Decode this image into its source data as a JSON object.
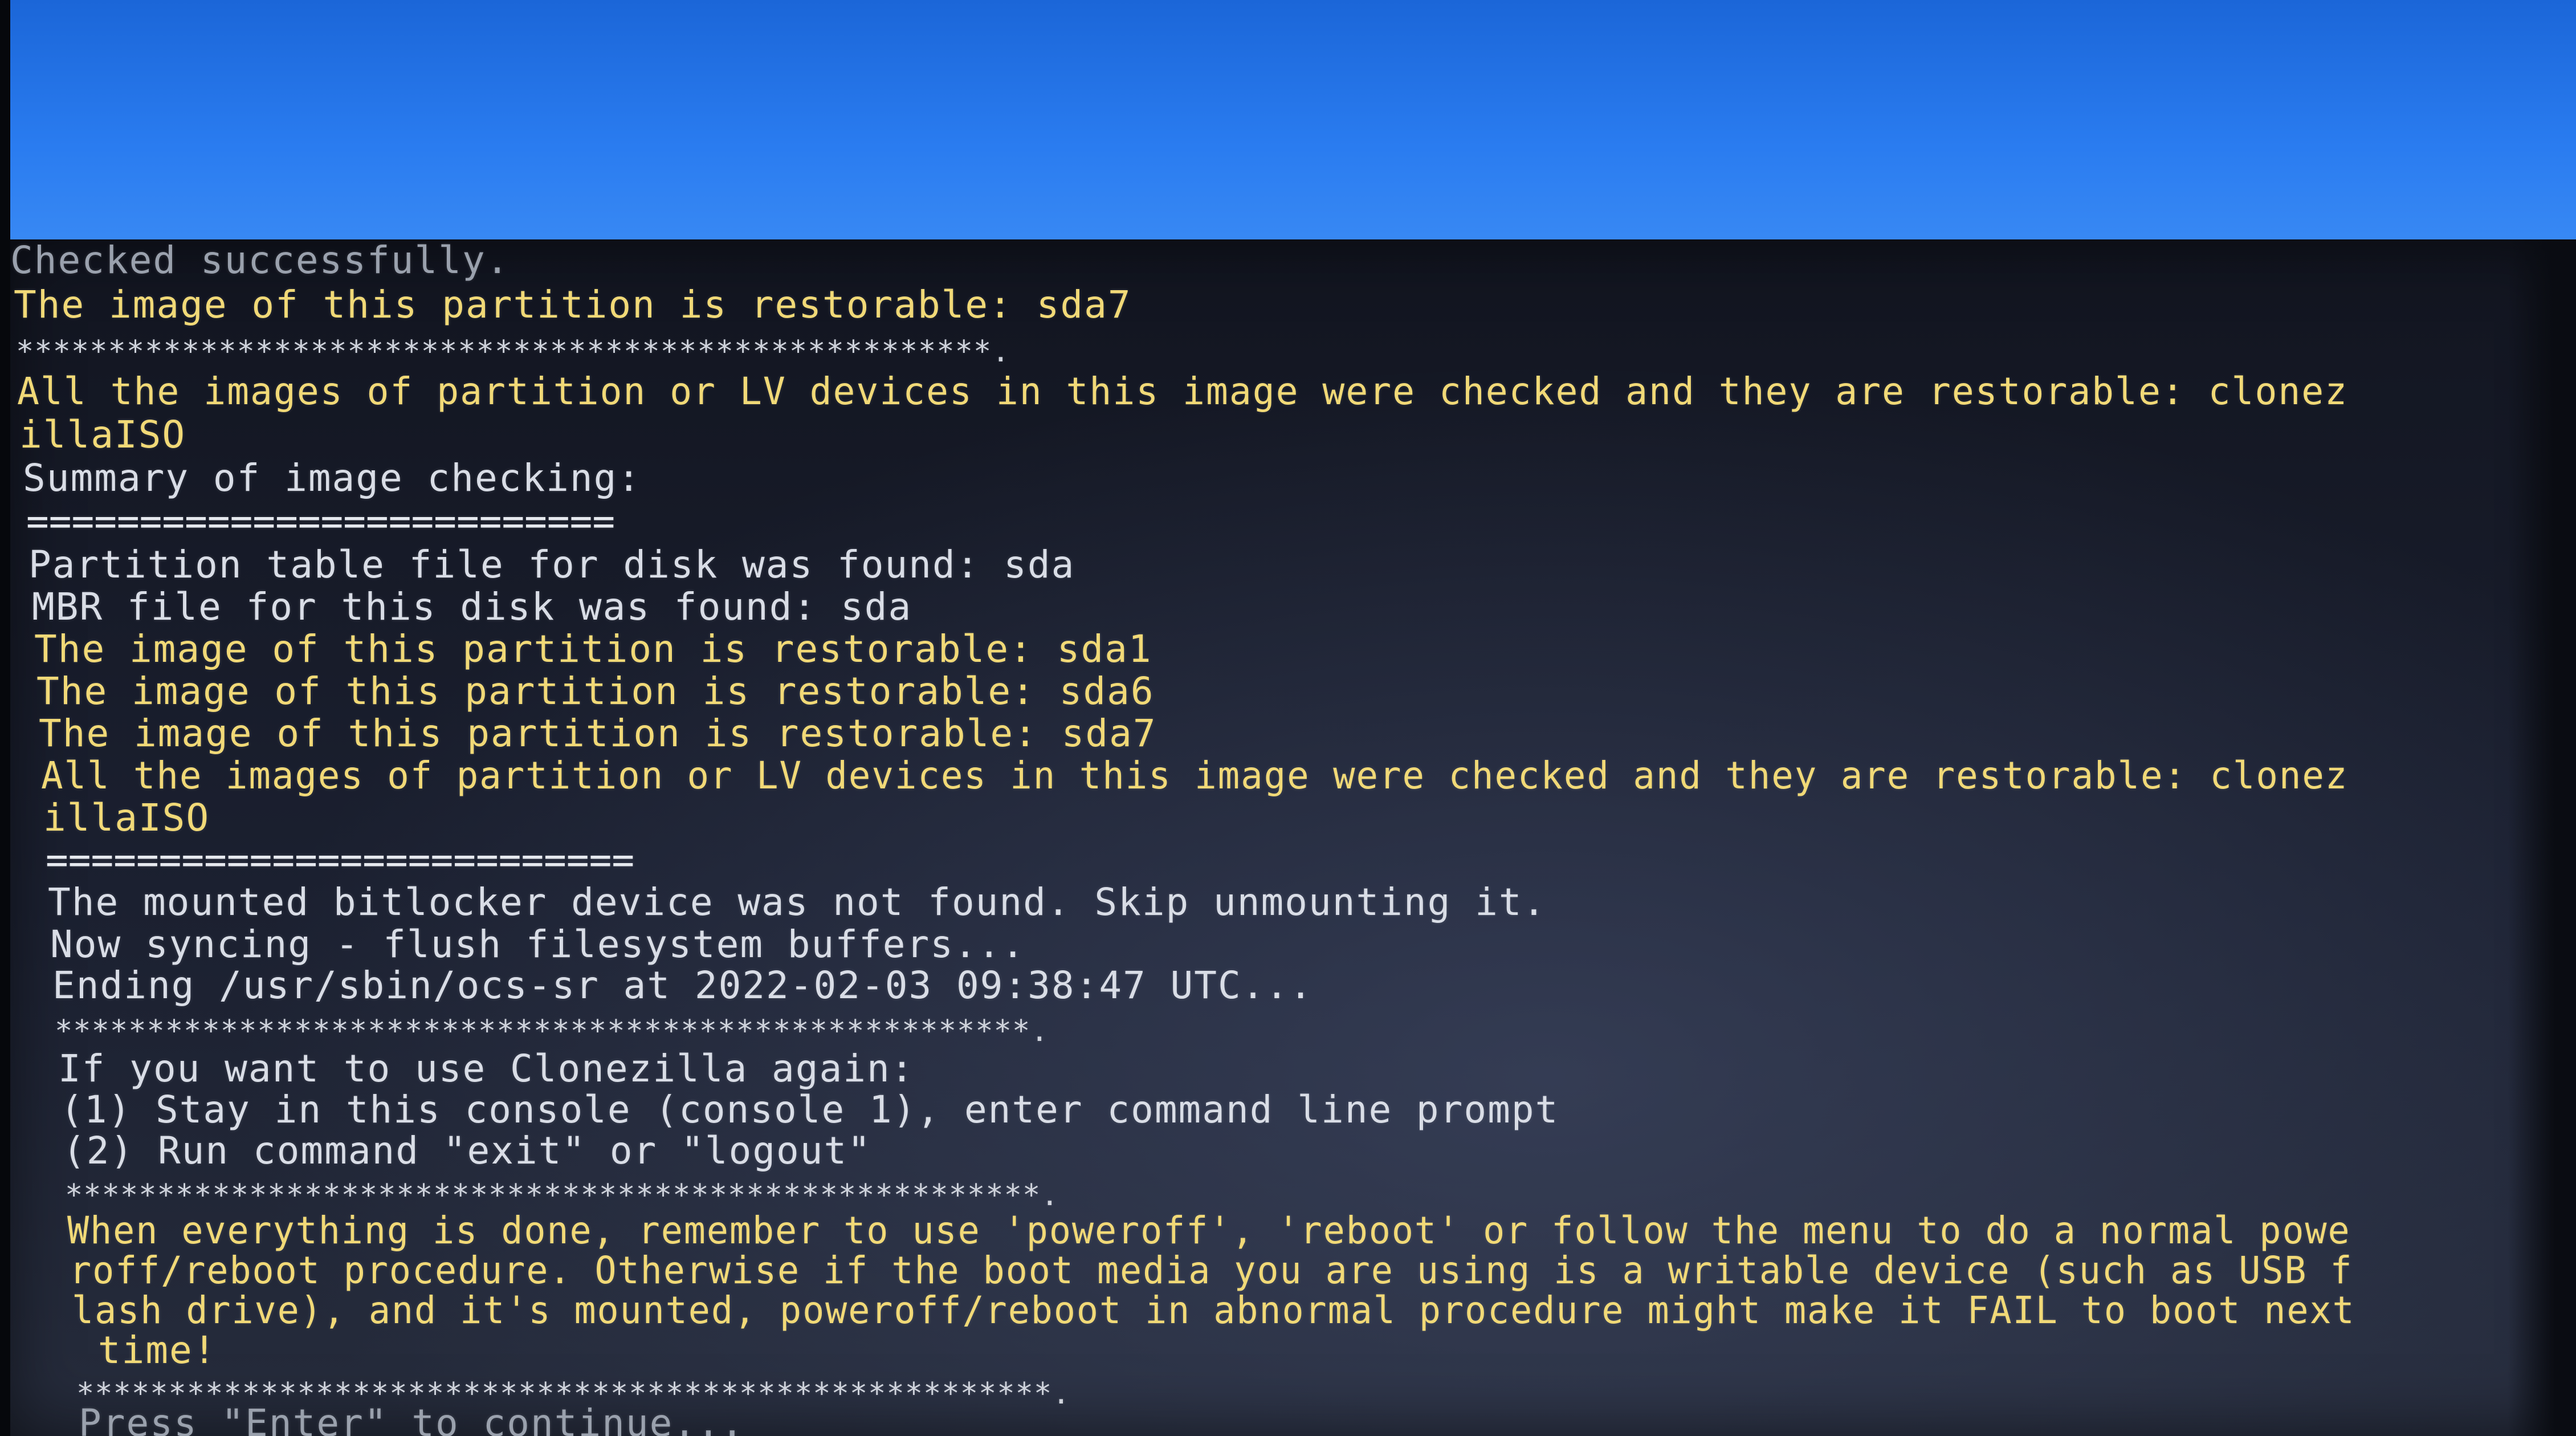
{
  "screen": {
    "lines": [
      "Checked successfully.",
      "The image of this partition is restorable: sda7",
      "*****************************************************.",
      "All the images of partition or LV devices in this image were checked and they are restorable: clonez",
      "illaISO",
      "Summary of image checking:",
      "==========================",
      "Partition table file for disk was found: sda",
      "MBR file for this disk was found: sda",
      "The image of this partition is restorable: sda1",
      "The image of this partition is restorable: sda6",
      "The image of this partition is restorable: sda7",
      "All the images of partition or LV devices in this image were checked and they are restorable: clonez",
      "illaISO",
      "==========================",
      "The mounted bitlocker device was not found. Skip unmounting it.",
      "Now syncing - flush filesystem buffers...",
      "Ending /usr/sbin/ocs-sr at 2022-02-03 09:38:47 UTC...",
      "*****************************************************.",
      "If you want to use Clonezilla again:",
      "(1) Stay in this console (console 1), enter command line prompt",
      "(2) Run command \"exit\" or \"logout\"",
      "*****************************************************.",
      "When everything is done, remember to use 'poweroff', 'reboot' or follow the menu to do a normal powe",
      "roff/reboot procedure. Otherwise if the boot media you are using is a writable device (such as USB f",
      "lash drive), and it's mounted, poweroff/reboot in abnormal procedure might make it FAIL to boot next",
      " time!",
      "*****************************************************.",
      "Press \"Enter\" to continue..."
    ]
  }
}
